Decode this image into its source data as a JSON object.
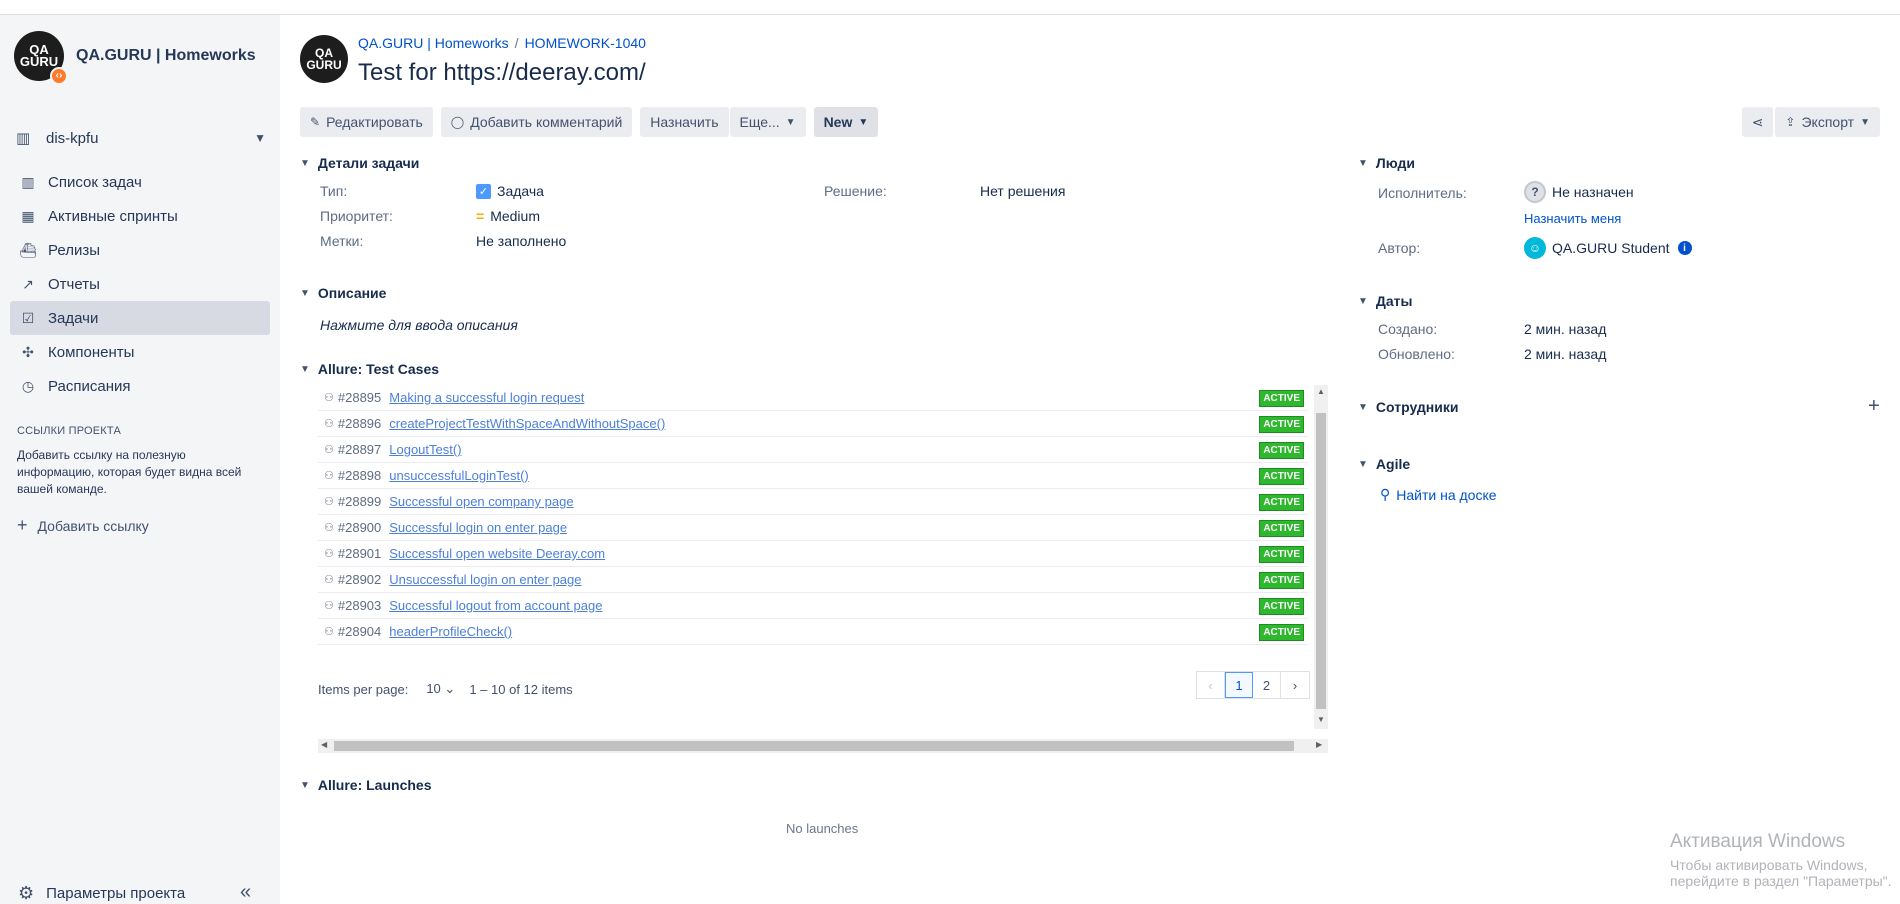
{
  "sidebar": {
    "project_name": "QA.GURU | Homeworks",
    "logo_text": "QA GURU",
    "board": "dis-kpfu",
    "nav": [
      {
        "label": "Список задач",
        "icon": "backlog-icon"
      },
      {
        "label": "Активные спринты",
        "icon": "board-icon"
      },
      {
        "label": "Релизы",
        "icon": "ship-icon"
      },
      {
        "label": "Отчеты",
        "icon": "chart-icon"
      },
      {
        "label": "Задачи",
        "icon": "issues-icon"
      },
      {
        "label": "Компоненты",
        "icon": "puzzle-icon"
      },
      {
        "label": "Расписания",
        "icon": "clock-icon"
      }
    ],
    "links_title": "ССЫЛКИ ПРОЕКТА",
    "links_text": "Добавить ссылку на полезную информацию, которая будет видна всей вашей команде.",
    "add_link": "Добавить ссылку",
    "project_settings": "Параметры проекта"
  },
  "header": {
    "breadcrumb_project": "QA.GURU | Homeworks",
    "breadcrumb_sep": "/",
    "breadcrumb_issue": "HOMEWORK-1040",
    "title": "Test for https://deeray.com/"
  },
  "toolbar": {
    "edit": "Редактировать",
    "comment": "Добавить комментарий",
    "assign": "Назначить",
    "more": "Еще...",
    "status": "New",
    "export": "Экспорт"
  },
  "details": {
    "title": "Детали задачи",
    "type_label": "Тип:",
    "type_value": "Задача",
    "priority_label": "Приоритет:",
    "priority_value": "Medium",
    "labels_label": "Метки:",
    "labels_value": "Не заполнено",
    "resolution_label": "Решение:",
    "resolution_value": "Нет решения"
  },
  "description": {
    "title": "Описание",
    "hint": "Нажмите для ввода описания"
  },
  "test_cases": {
    "title": "Allure: Test Cases",
    "rows": [
      {
        "id": "#28895",
        "name": "Making a successful login request",
        "status": "ACTIVE"
      },
      {
        "id": "#28896",
        "name": "createProjectTestWithSpaceAndWithoutSpace()",
        "status": "ACTIVE"
      },
      {
        "id": "#28897",
        "name": "LogoutTest()",
        "status": "ACTIVE"
      },
      {
        "id": "#28898",
        "name": "unsuccessfulLoginTest()",
        "status": "ACTIVE"
      },
      {
        "id": "#28899",
        "name": "Successful open company page",
        "status": "ACTIVE"
      },
      {
        "id": "#28900",
        "name": "Successful login on enter page",
        "status": "ACTIVE"
      },
      {
        "id": "#28901",
        "name": "Successful open website Deeray.com",
        "status": "ACTIVE"
      },
      {
        "id": "#28902",
        "name": "Unsuccessful login on enter page",
        "status": "ACTIVE"
      },
      {
        "id": "#28903",
        "name": "Successful logout from account page",
        "status": "ACTIVE"
      },
      {
        "id": "#28904",
        "name": "headerProfileCheck()",
        "status": "ACTIVE"
      }
    ],
    "items_per_page_label": "Items per page:",
    "items_per_page": "10",
    "range": "1 – 10 of 12 items",
    "pages": [
      "1",
      "2"
    ],
    "current_page": "1"
  },
  "launches": {
    "title": "Allure: Launches",
    "empty": "No launches"
  },
  "people": {
    "title": "Люди",
    "assignee_label": "Исполнитель:",
    "assignee_value": "Не назначен",
    "assign_me": "Назначить меня",
    "author_label": "Автор:",
    "author_value": "QA.GURU Student"
  },
  "dates": {
    "title": "Даты",
    "created_label": "Создано:",
    "created_value": "2 мин. назад",
    "updated_label": "Обновлено:",
    "updated_value": "2 мин. назад"
  },
  "employees": {
    "title": "Сотрудники"
  },
  "agile": {
    "title": "Agile",
    "find_on_board": "Найти на доске"
  },
  "windows": {
    "title": "Активация Windows",
    "text": "Чтобы активировать Windows, перейдите в раздел \"Параметры\"."
  }
}
